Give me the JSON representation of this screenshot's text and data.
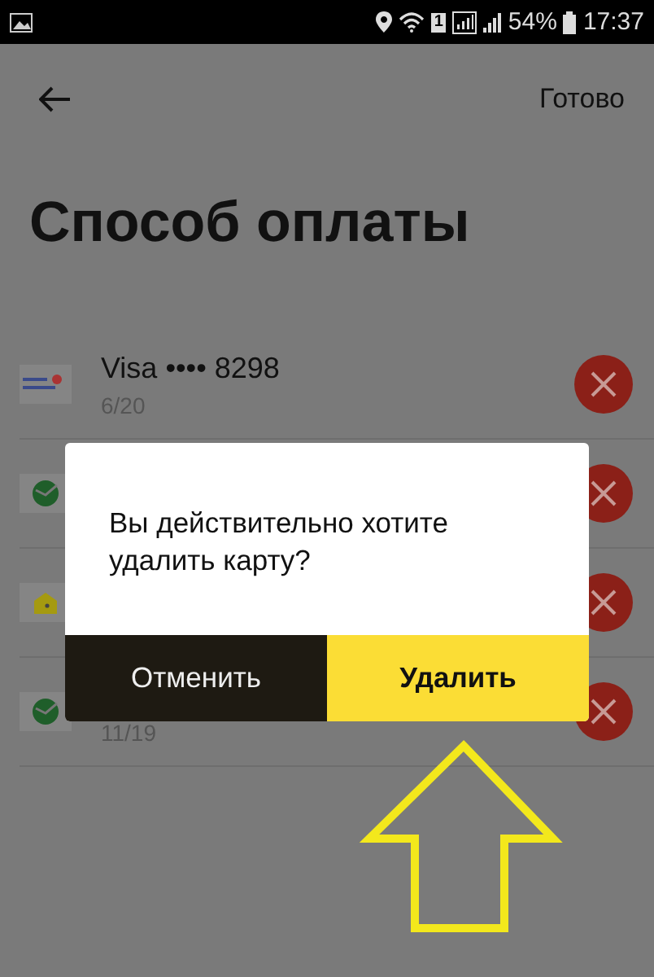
{
  "status_bar": {
    "sim": "1",
    "battery": "54%",
    "time": "17:37"
  },
  "header": {
    "done": "Готово"
  },
  "title": "Способ оплаты",
  "cards": [
    {
      "kind": "kredit",
      "name": "Visa •••• 8298",
      "expiry": "6/20"
    },
    {
      "kind": "sber"
    },
    {
      "kind": "wallet"
    },
    {
      "kind": "sber",
      "expiry": "11/19"
    }
  ],
  "dialog": {
    "message": "Вы действительно хотите удалить карту?",
    "buttons": [
      {
        "kind": "cancel",
        "label": "Отменить"
      },
      {
        "kind": "confirm",
        "label": "Удалить"
      }
    ]
  }
}
